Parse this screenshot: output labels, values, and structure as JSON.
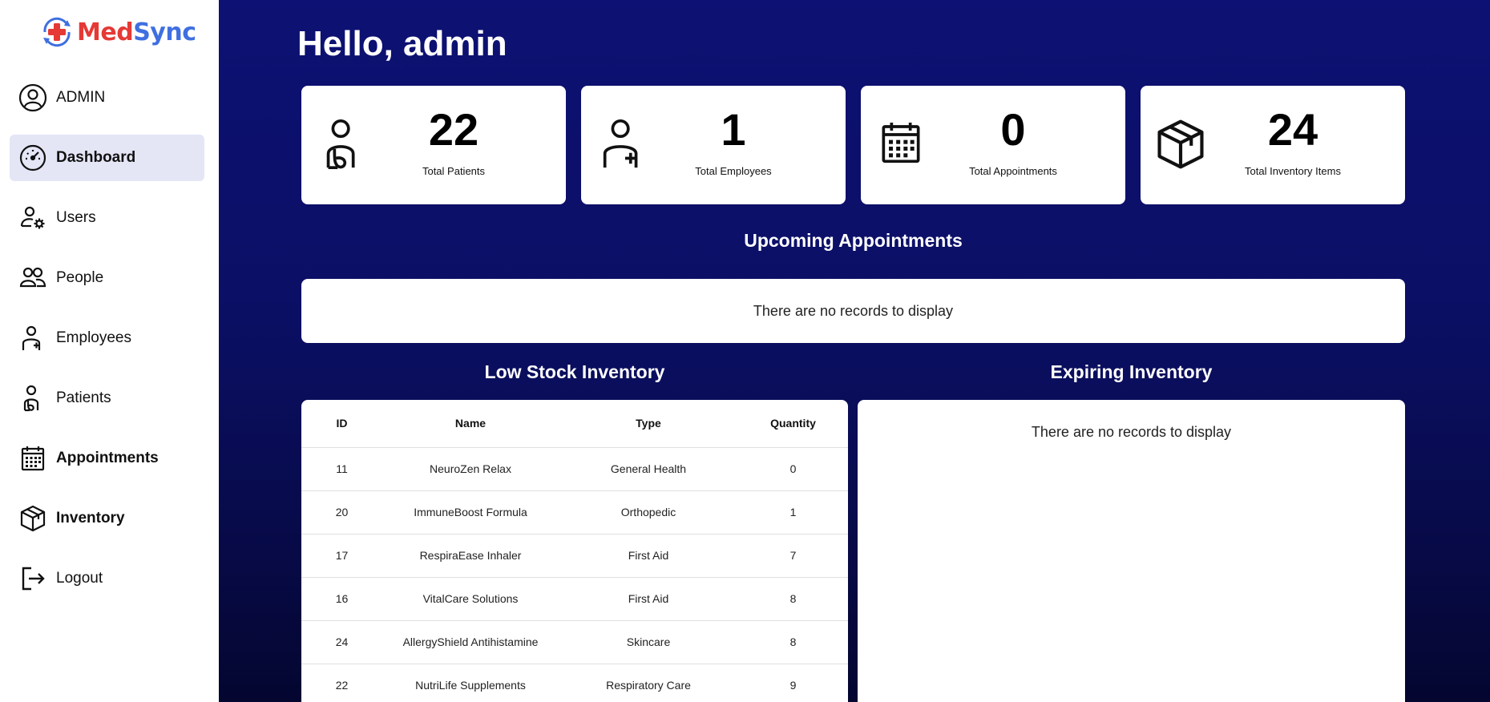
{
  "app": {
    "brand_part1": "Med",
    "brand_part2": "Sync",
    "brand_color_red": "#e53935",
    "brand_color_blue": "#3f6fe0",
    "main_bg_color": "#0d1173"
  },
  "sidebar": {
    "user_label": "ADMIN",
    "items": [
      {
        "label": "Dashboard",
        "icon": "gauge-icon",
        "active": true
      },
      {
        "label": "Users",
        "icon": "user-gear-icon"
      },
      {
        "label": "People",
        "icon": "people-icon"
      },
      {
        "label": "Employees",
        "icon": "user-plus-icon"
      },
      {
        "label": "Patients",
        "icon": "patient-icon"
      },
      {
        "label": "Appointments",
        "icon": "calendar-icon"
      },
      {
        "label": "Inventory",
        "icon": "box-icon"
      },
      {
        "label": "Logout",
        "icon": "logout-icon"
      }
    ]
  },
  "main": {
    "greeting": "Hello, admin",
    "stats": [
      {
        "value": "22",
        "label": "Total Patients",
        "icon": "patient-icon"
      },
      {
        "value": "1",
        "label": "Total Employees",
        "icon": "user-plus-icon"
      },
      {
        "value": "0",
        "label": "Total Appointments",
        "icon": "calendar-icon"
      },
      {
        "value": "24",
        "label": "Total Inventory Items",
        "icon": "box-icon"
      }
    ],
    "upcoming": {
      "title": "Upcoming Appointments",
      "empty_text": "There are no records to display"
    },
    "low_stock": {
      "title": "Low Stock Inventory",
      "columns": [
        "ID",
        "Name",
        "Type",
        "Quantity"
      ],
      "rows": [
        [
          "11",
          "NeuroZen Relax",
          "General Health",
          "0"
        ],
        [
          "20",
          "ImmuneBoost Formula",
          "Orthopedic",
          "1"
        ],
        [
          "17",
          "RespiraEase Inhaler",
          "First Aid",
          "7"
        ],
        [
          "16",
          "VitalCare Solutions",
          "First Aid",
          "8"
        ],
        [
          "24",
          "AllergyShield Antihistamine",
          "Skincare",
          "8"
        ],
        [
          "22",
          "NutriLife Supplements",
          "Respiratory Care",
          "9"
        ]
      ]
    },
    "expiring": {
      "title": "Expiring Inventory",
      "empty_text": "There are no records to display"
    }
  }
}
